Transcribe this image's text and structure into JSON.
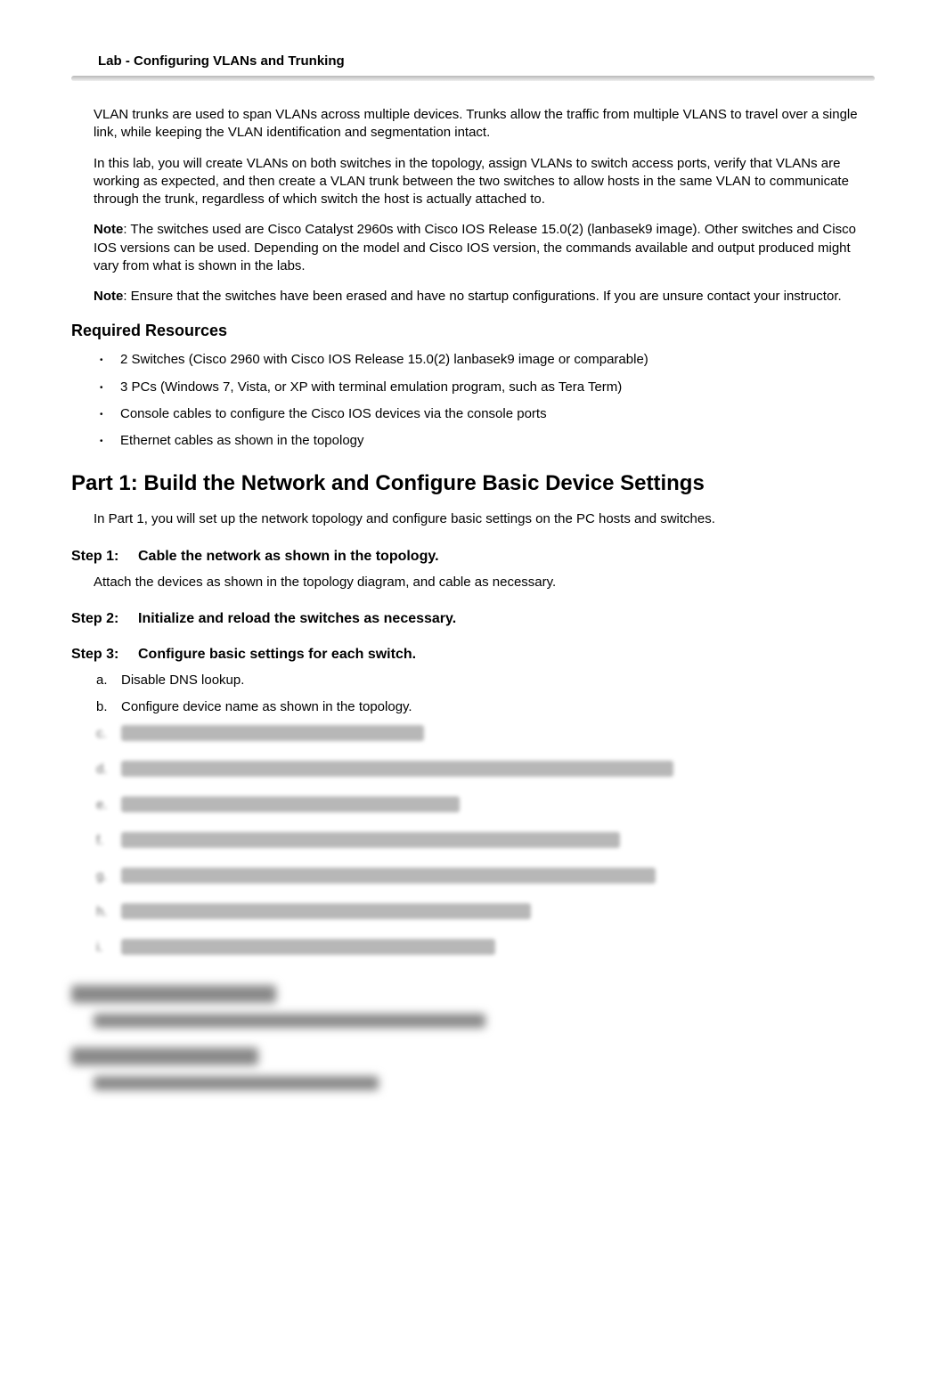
{
  "header": {
    "title": "Lab - Configuring VLANs and Trunking"
  },
  "intro": {
    "p1": "VLAN trunks are used to span VLANs across multiple devices. Trunks allow the traffic from multiple VLANS to travel over a single link, while keeping the VLAN identification and segmentation intact.",
    "p2": "In this lab, you will create VLANs on both switches in the topology, assign VLANs to switch access ports, verify that VLANs are working as expected, and then create a VLAN trunk between the two switches to allow hosts in the same VLAN to communicate through the trunk, regardless of which switch the host is actually attached to.",
    "note1_label": "Note",
    "note1_text": ": The switches used are Cisco Catalyst 2960s with Cisco IOS Release 15.0(2) (lanbasek9 image). Other switches and Cisco IOS versions can be used. Depending on the model and Cisco IOS version, the commands available and output produced might vary from what is shown in the labs.",
    "note2_label": "Note",
    "note2_text": ": Ensure that the switches have been erased and have no startup configurations. If you are unsure contact your instructor."
  },
  "required": {
    "heading": "Required Resources",
    "items": [
      "2 Switches (Cisco 2960 with Cisco IOS Release 15.0(2) lanbasek9 image or comparable)",
      "3 PCs (Windows 7, Vista, or XP with terminal emulation program, such as Tera Term)",
      "Console cables to configure the Cisco IOS devices via the console ports",
      "Ethernet cables as shown in the topology"
    ]
  },
  "part1": {
    "heading": "Part 1: Build the Network and Configure Basic Device Settings",
    "intro": "In Part 1, you will set up the network topology and configure basic settings on the PC hosts and switches.",
    "step1_label": "Step 1:",
    "step1_title": "Cable the network as shown in the topology.",
    "step1_text": "Attach the devices as shown in the topology diagram, and cable as necessary.",
    "step2_label": "Step 2:",
    "step2_title": "Initialize and reload the switches as necessary.",
    "step3_label": "Step 3:",
    "step3_title": "Configure basic settings for each switch.",
    "step3_items": {
      "a": "Disable  DNS  lookup.",
      "b": "Configure device name as shown in the topology."
    }
  }
}
